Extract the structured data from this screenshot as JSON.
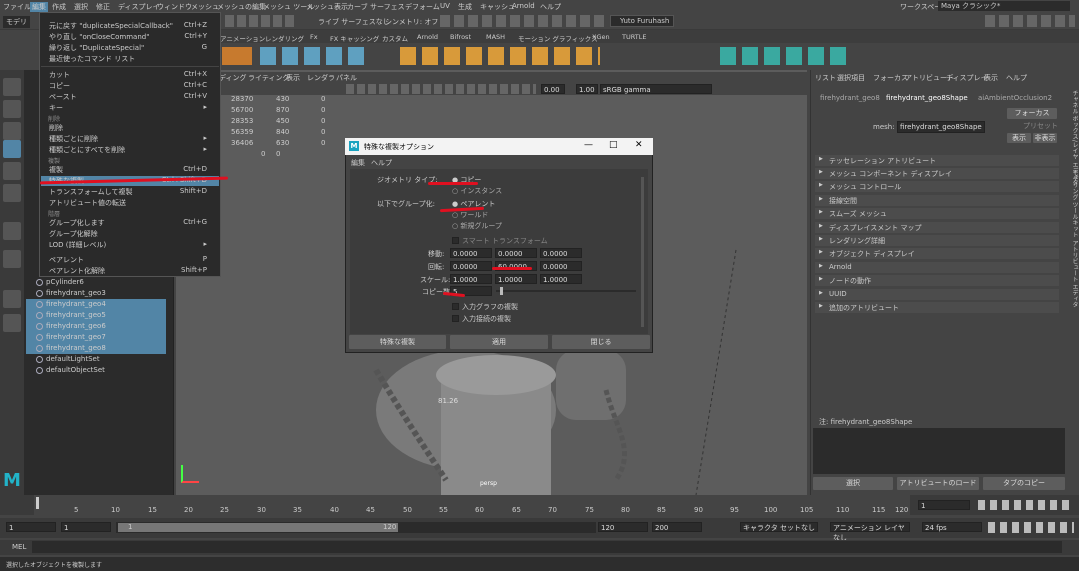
{
  "menubar": [
    "ファイル",
    "編集",
    "作成",
    "選択",
    "修正",
    "ディスプレイ",
    "ウィンドウ",
    "メッシュ",
    "メッシュの編集",
    "メッシュ ツール",
    "メッシュ表示",
    "カーブ",
    "サーフェス",
    "デフォーム",
    "UV",
    "生成",
    "キャッシュ",
    "Arnold",
    "ヘルプ"
  ],
  "workspace": {
    "label": "ワークスペース:",
    "value": "Maya クラシック*"
  },
  "status": {
    "modeling": "モデリ",
    "symmetry": "シンメトリ: オフ",
    "live": "ライブ サーフェスなし",
    "user": "Yuto Furuhash"
  },
  "shelf_tabs": [
    "アニメーション",
    "レンダリング",
    "Fx",
    "FX キャッシング",
    "カスタム",
    "Arnold",
    "Bifrost",
    "MASH",
    "モーション グラフィックス",
    "XGen",
    "TURTLE"
  ],
  "edit_menu": {
    "items": [
      {
        "label": "元に戻す \"duplicateSpecialCallback\"",
        "shortcut": "Ctrl+Z"
      },
      {
        "label": "やり直し \"onCloseCommand\"",
        "shortcut": "Ctrl+Y"
      },
      {
        "label": "繰り返し \"DuplicateSpecial\"",
        "shortcut": "G"
      },
      {
        "label": "最近使ったコマンド リスト",
        "shortcut": ""
      },
      {
        "label": "カット",
        "shortcut": "Ctrl+X"
      },
      {
        "label": "コピー",
        "shortcut": "Ctrl+C"
      },
      {
        "label": "ペースト",
        "shortcut": "Ctrl+V"
      },
      {
        "label": "キー",
        "shortcut": "▸"
      },
      {
        "label": "削除",
        "shortcut": ""
      },
      {
        "label": "種類ごとに削除",
        "shortcut": "▸"
      },
      {
        "label": "種類ごとにすべてを削除",
        "shortcut": "▸"
      },
      {
        "label": "複製",
        "shortcut": "Ctrl+D"
      },
      {
        "label": "特殊な複製",
        "shortcut": "Ctrl+Shift+D"
      },
      {
        "label": "トランスフォームして複製",
        "shortcut": "Shift+D"
      },
      {
        "label": "アトリビュート値の転送",
        "shortcut": ""
      },
      {
        "label": "グループ化します",
        "shortcut": "Ctrl+G"
      },
      {
        "label": "グループ化解除",
        "shortcut": ""
      },
      {
        "label": "LOD (詳細レベル)",
        "shortcut": "▸"
      },
      {
        "label": "ペアレント",
        "shortcut": "P"
      },
      {
        "label": "ペアレント化解除",
        "shortcut": "Shift+P"
      }
    ],
    "headers": [
      "削除",
      "複製",
      "階層"
    ]
  },
  "outliner": {
    "items": [
      "pCylinder6",
      "firehydrant_geo3",
      "firehydrant_geo4",
      "firehydrant_geo5",
      "firehydrant_geo6",
      "firehydrant_geo7",
      "firehydrant_geo8",
      "defaultLightSet",
      "defaultObjectSet"
    ]
  },
  "viewport": {
    "menu": [
      "ディング",
      "ライティング",
      "表示",
      "レンダラ",
      "パネル"
    ],
    "gamma": "sRGB gamma",
    "exposure": "0.00",
    "gamma_val": "1.00",
    "stats": [
      [
        "28370",
        "430",
        "0"
      ],
      [
        "56700",
        "870",
        "0"
      ],
      [
        "28353",
        "450",
        "0"
      ],
      [
        "56359",
        "840",
        "0"
      ],
      [
        "36406",
        "630",
        "0"
      ],
      [
        "0",
        "0",
        ""
      ]
    ],
    "cam_label": "persp",
    "coord": "81.26"
  },
  "dialog": {
    "title": "特殊な複製オプション",
    "menu": [
      "編集",
      "ヘルプ"
    ],
    "geom_label": "ジオメトリ タイプ:",
    "geom_opts": [
      "コピー",
      "インスタンス"
    ],
    "group_label": "以下でグループ化:",
    "group_opts": [
      "ペアレント",
      "ワールド",
      "新規グループ"
    ],
    "smart": "スマート トランスフォーム",
    "translate_label": "移動:",
    "translate": [
      "0.0000",
      "0.0000",
      "0.0000"
    ],
    "rotate_label": "回転:",
    "rotate": [
      "0.0000",
      "60.0000",
      "0.0000"
    ],
    "scale_label": "スケール:",
    "scale": [
      "1.0000",
      "1.0000",
      "1.0000"
    ],
    "copies_label": "コピー数:",
    "copies": "5",
    "checks": [
      "入力グラフの複製",
      "入力接続の複製"
    ],
    "buttons": [
      "特殊な複製",
      "適用",
      "閉じる"
    ],
    "controls": [
      "—",
      "□",
      "✕"
    ]
  },
  "attr": {
    "menu": [
      "リスト",
      "選択項目",
      "フォーカス",
      "アトリビュート",
      "ディスプレイ",
      "表示",
      "ヘルプ"
    ],
    "tabs": [
      "firehydrant_geo8",
      "firehydrant_geo8Shape",
      "aiAmbientOcclusion2"
    ],
    "mesh_label": "mesh:",
    "mesh_value": "firehydrant_geo8Shape",
    "focus": "フォーカス",
    "preset": "プリセット",
    "show": "表示",
    "hide": "非表示",
    "sections": [
      "テッセレーション アトリビュート",
      "メッシュ コンポーネント ディスプレイ",
      "メッシュ コントロール",
      "接線空間",
      "スムーズ メッシュ",
      "ディスプレイスメント マップ",
      "レンダリング詳細",
      "オブジェクト ディスプレイ",
      "Arnold",
      "ノードの動作",
      "UUID",
      "追加のアトリビュート"
    ],
    "note": "注: firehydrant_geo8Shape",
    "bottom": [
      "選択",
      "アトリビュートのロード",
      "タブのコピー"
    ],
    "side": [
      "チャネル ボックス/レイヤ エディタ",
      "モデリング ツールキット",
      "アトリビュート エディタ"
    ]
  },
  "timeline": {
    "ticks": [
      "5",
      "10",
      "15",
      "20",
      "25",
      "30",
      "35",
      "40",
      "45",
      "50",
      "55",
      "60",
      "65",
      "70",
      "75",
      "80",
      "85",
      "90",
      "95",
      "100",
      "105",
      "110",
      "115",
      "120"
    ],
    "current": "1"
  },
  "range": {
    "start": "1",
    "start2": "1",
    "bar_start": "1",
    "bar_end": "120",
    "end": "120",
    "end2": "200",
    "char": "キャラクタ セットなし",
    "anim": "アニメーション レイヤなし",
    "fps": "24 fps"
  },
  "mel": "MEL",
  "help": "選択したオブジェクトを複製します"
}
